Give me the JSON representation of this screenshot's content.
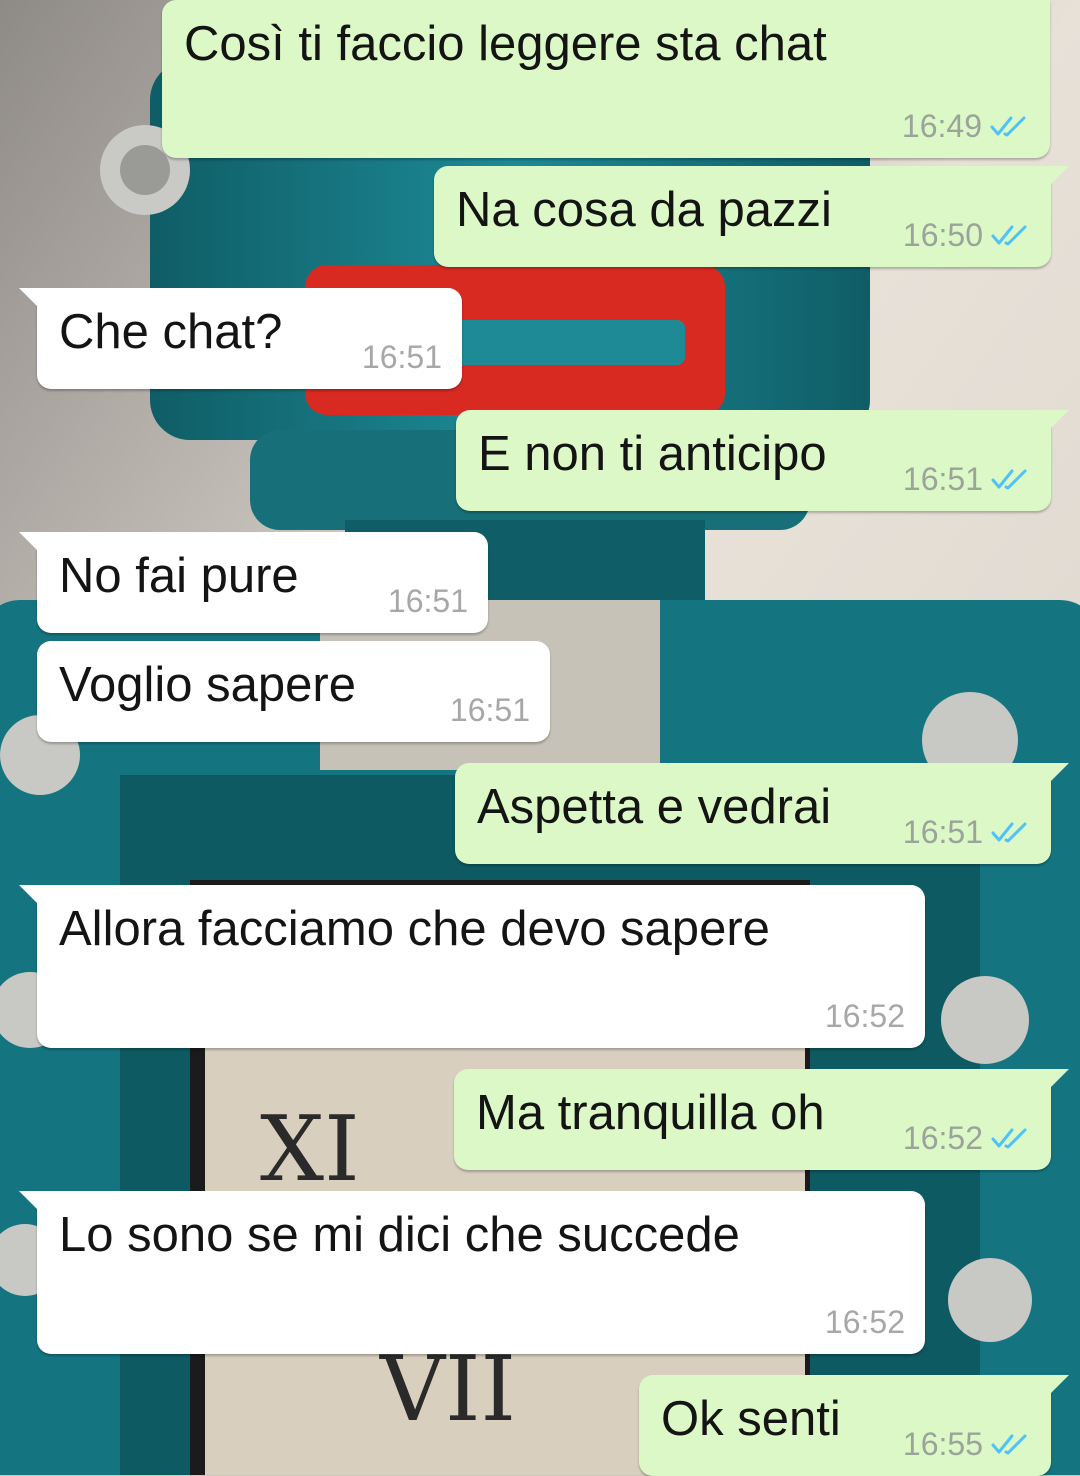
{
  "colors": {
    "outgoing_bubble": "#dcf8c6",
    "incoming_bubble": "#ffffff",
    "read_ticks": "#4fc3f7",
    "timestamp": "#9aa49a"
  },
  "messages": [
    {
      "direction": "out",
      "text": "Così ti faccio leggere sta chat",
      "time": "16:49",
      "status": "read-double-tick-icon"
    },
    {
      "direction": "out",
      "text": "Na cosa da pazzi",
      "time": "16:50",
      "status": "read-double-tick-icon"
    },
    {
      "direction": "in",
      "text": "Che chat?",
      "time": "16:51"
    },
    {
      "direction": "out",
      "text": "E non ti anticipo",
      "time": "16:51",
      "status": "read-double-tick-icon"
    },
    {
      "direction": "in",
      "text": "No fai pure",
      "time": "16:51"
    },
    {
      "direction": "in",
      "text": "Voglio sapere",
      "time": "16:51"
    },
    {
      "direction": "out",
      "text": "Aspetta e vedrai",
      "time": "16:51",
      "status": "read-double-tick-icon"
    },
    {
      "direction": "in",
      "text": "Allora facciamo che devo sapere",
      "time": "16:52"
    },
    {
      "direction": "out",
      "text": "Ma tranquilla oh",
      "time": "16:52",
      "status": "read-double-tick-icon"
    },
    {
      "direction": "in",
      "text": "Lo sono se mi dici che succede",
      "time": "16:52"
    },
    {
      "direction": "out",
      "text": "Ok senti",
      "time": "16:55",
      "status": "read-double-tick-icon"
    }
  ]
}
